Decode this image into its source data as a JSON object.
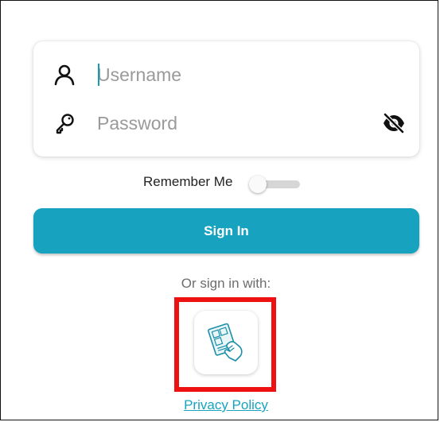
{
  "login": {
    "username_placeholder": "Username",
    "password_placeholder": "Password"
  },
  "remember": {
    "label": "Remember Me",
    "checked": false
  },
  "actions": {
    "sign_in_label": "Sign In"
  },
  "alt_sign_in": {
    "prompt": "Or sign in with:",
    "option_icon": "card-scan-icon"
  },
  "footer": {
    "privacy_label": "Privacy Policy"
  },
  "colors": {
    "accent": "#17a3c0",
    "highlight": "#ee1111"
  },
  "icons": {
    "username": "user-icon",
    "password": "key-icon",
    "visibility": "eye-off-icon"
  }
}
